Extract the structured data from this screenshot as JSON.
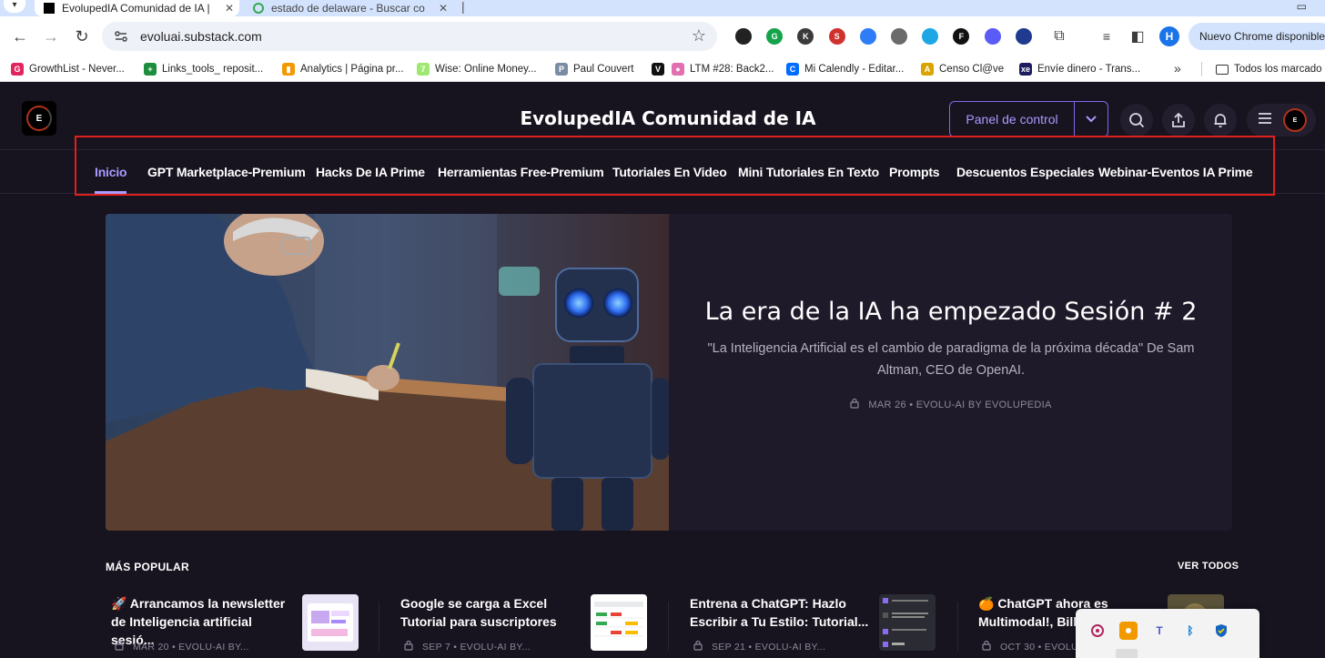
{
  "browser": {
    "tabs": [
      {
        "title": "EvolupedIA Comunidad de IA |",
        "active": true
      },
      {
        "title": "estado de delaware - Buscar co",
        "active": false
      }
    ],
    "url": "evoluai.substack.com",
    "profile_initial": "H",
    "update_label": "Nuevo Chrome disponible",
    "extensions": [
      {
        "name": "eyedropper-icon",
        "label": "",
        "color": "#222222"
      },
      {
        "name": "grammarly-icon",
        "label": "G",
        "color": "#15a34a"
      },
      {
        "name": "k-extension-icon",
        "label": "K",
        "color": "#3a3a3a"
      },
      {
        "name": "seo-extension-icon",
        "label": "S",
        "color": "#d0312d"
      },
      {
        "name": "tab-extension-icon",
        "label": "",
        "color": "#2f7df6"
      },
      {
        "name": "record-extension-icon",
        "label": "",
        "color": "#6b6b6b"
      },
      {
        "name": "screenshot-extension-icon",
        "label": "",
        "color": "#1ea7e4"
      },
      {
        "name": "f-extension-icon",
        "label": "F",
        "color": "#111111"
      },
      {
        "name": "sparkle-extension-icon",
        "label": "",
        "color": "#5b5bf7"
      },
      {
        "name": "alien-extension-icon",
        "label": "",
        "color": "#203a8f"
      }
    ],
    "bookmarks": [
      {
        "label": "GrowthList - Never...",
        "color": "#e0245e",
        "glyph": "G"
      },
      {
        "label": "Links_tools_ reposit...",
        "color": "#1e8e3e",
        "glyph": "+"
      },
      {
        "label": "Analytics | Página pr...",
        "color": "#f29900",
        "glyph": "▮"
      },
      {
        "label": "Wise: Online Money...",
        "color": "#9fe870",
        "glyph": "7"
      },
      {
        "label": "Paul Couvert",
        "color": "#7a8ca3",
        "glyph": "P"
      },
      {
        "label": "",
        "color": "#111111",
        "glyph": "V"
      },
      {
        "label": "LTM #28: Back2...",
        "color": "#e26fb0",
        "glyph": "●"
      },
      {
        "label": "Mi Calendly - Editar...",
        "color": "#006bff",
        "glyph": "C"
      },
      {
        "label": "Censo Cl@ve",
        "color": "#d9a400",
        "glyph": "A"
      },
      {
        "label": "Envíe dinero - Trans...",
        "color": "#1c1c5e",
        "glyph": "xe"
      }
    ],
    "bookmarks_folder": "Todos los marcado"
  },
  "site": {
    "logo_letter": "E",
    "title": "EvolupedIA Comunidad de IA",
    "panel_button": "Panel de control",
    "nav": [
      {
        "label": "Inicio",
        "active": true
      },
      {
        "label": "GPT Marketplace-Premium",
        "active": false
      },
      {
        "label": "Hacks De IA Prime",
        "active": false
      },
      {
        "label": "Herramientas Free-Premium",
        "active": false
      },
      {
        "label": "Tutoriales En Video",
        "active": false
      },
      {
        "label": "Mini Tutoriales En Texto",
        "active": false
      },
      {
        "label": "Prompts",
        "active": false
      },
      {
        "label": "Descuentos Especiales",
        "active": false
      },
      {
        "label": "Webinar-Eventos IA Prime",
        "active": false
      }
    ],
    "hero": {
      "title": "La era de la IA ha empezado Sesión # 2",
      "subtitle": "\"La Inteligencia Artificial es el cambio de paradigma de la próxima década\" De Sam Altman, CEO de OpenAI.",
      "meta": "MAR 26 • EVOLU-AI BY EVOLUPEDIA"
    },
    "popular": {
      "heading": "MÁS POPULAR",
      "see_all": "VER TODOS",
      "posts": [
        {
          "title": "🚀 Arrancamos la newsletter de Inteligencia artificial sesió...",
          "meta": "MAR 20 • EVOLU-AI BY..."
        },
        {
          "title": "Google se carga a Excel Tutorial para suscriptores",
          "meta": "SEP 7 • EVOLU-AI BY..."
        },
        {
          "title": "Entrena a ChatGPT: Hazlo Escribir a Tu Estilo: Tutorial...",
          "meta": "SEP 21 • EVOLU-AI BY..."
        },
        {
          "title": "🍊 ChatGPT ahora es Multimodal!, Bill",
          "meta": "OCT 30 • EVOLU"
        }
      ]
    }
  },
  "colors": {
    "accent": "#a99bff",
    "page_bg": "#17131f",
    "highlight": "#e0201b"
  }
}
